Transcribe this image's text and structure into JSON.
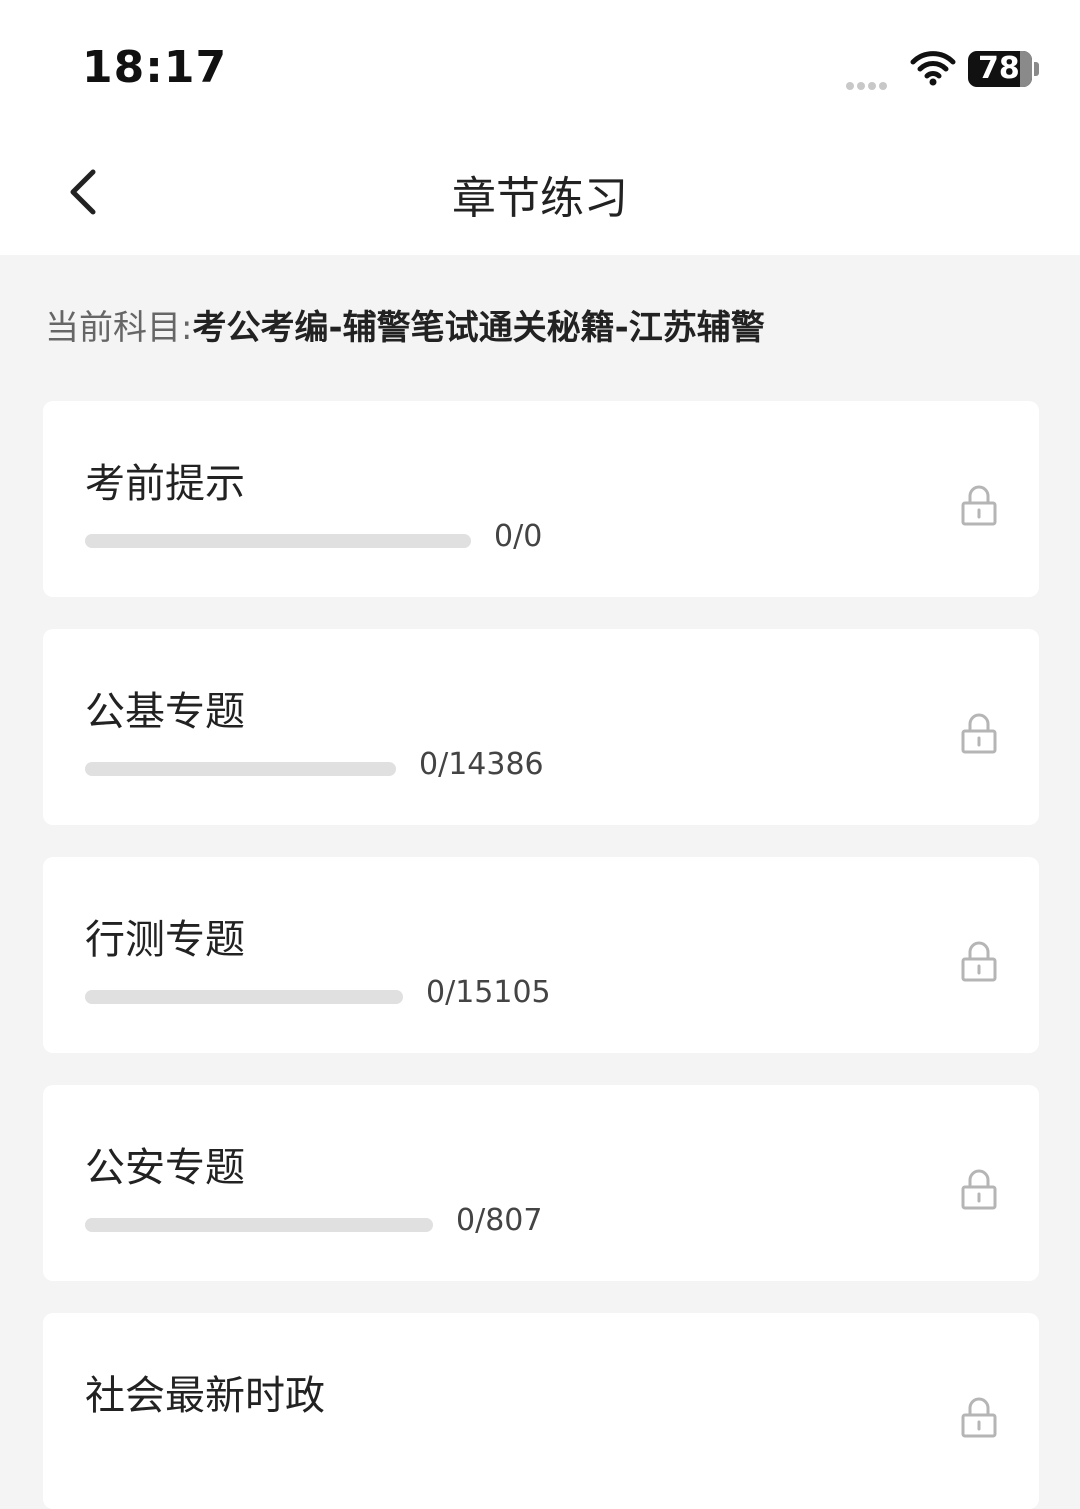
{
  "status_bar": {
    "time": "18:17",
    "battery": "78",
    "icons": [
      "signal-dots-icon",
      "wifi-icon",
      "battery-icon"
    ]
  },
  "nav": {
    "back_icon": "chevron-left-icon",
    "title": "章节练习"
  },
  "subject": {
    "prefix": "当前科目:",
    "value": "考公考编-辅警笔试通关秘籍-江苏辅警"
  },
  "chapters": [
    {
      "title": "考前提示",
      "count": "0/0",
      "progress": 0,
      "locked": true
    },
    {
      "title": "公基专题",
      "count": "0/14386",
      "progress": 0,
      "locked": true
    },
    {
      "title": "行测专题",
      "count": "0/15105",
      "progress": 0,
      "locked": true
    },
    {
      "title": "公安专题",
      "count": "0/807",
      "progress": 0,
      "locked": true
    },
    {
      "title": "社会最新时政",
      "count": "",
      "progress": 0,
      "locked": true
    }
  ],
  "colors": {
    "background": "#f4f4f4",
    "card": "#ffffff",
    "track": "#e0e0e0",
    "lock": "#b5b5b5"
  }
}
